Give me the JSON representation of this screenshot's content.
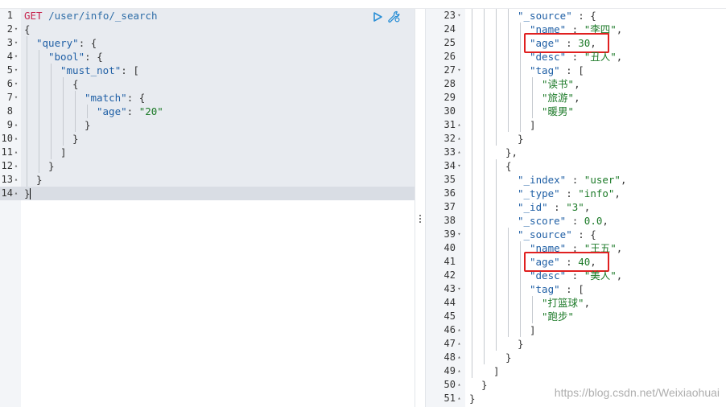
{
  "request": {
    "method": "GET",
    "path": "/user/info/_search",
    "lines": [
      {
        "n": "1",
        "fold": "",
        "indent": 0,
        "tokens": [
          [
            "kw-method",
            "GET"
          ],
          [
            "punc",
            " "
          ],
          [
            "kw-path",
            "/user/info/_search"
          ]
        ]
      },
      {
        "n": "2",
        "fold": "▾",
        "indent": 0,
        "tokens": [
          [
            "punc",
            "{"
          ]
        ]
      },
      {
        "n": "3",
        "fold": "▾",
        "indent": 1,
        "tokens": [
          [
            "key",
            "\"query\""
          ],
          [
            "punc",
            ": {"
          ]
        ]
      },
      {
        "n": "4",
        "fold": "▾",
        "indent": 2,
        "tokens": [
          [
            "key",
            "\"bool\""
          ],
          [
            "punc",
            ": {"
          ]
        ]
      },
      {
        "n": "5",
        "fold": "▾",
        "indent": 3,
        "tokens": [
          [
            "key",
            "\"must_not\""
          ],
          [
            "punc",
            ": ["
          ]
        ]
      },
      {
        "n": "6",
        "fold": "▾",
        "indent": 4,
        "tokens": [
          [
            "punc",
            "{"
          ]
        ]
      },
      {
        "n": "7",
        "fold": "▾",
        "indent": 5,
        "tokens": [
          [
            "key",
            "\"match\""
          ],
          [
            "punc",
            ": {"
          ]
        ]
      },
      {
        "n": "8",
        "fold": "",
        "indent": 6,
        "tokens": [
          [
            "key",
            "\"age\""
          ],
          [
            "punc",
            ": "
          ],
          [
            "str",
            "\"20\""
          ]
        ]
      },
      {
        "n": "9",
        "fold": "▴",
        "indent": 5,
        "tokens": [
          [
            "punc",
            "}"
          ]
        ]
      },
      {
        "n": "10",
        "fold": "▴",
        "indent": 4,
        "tokens": [
          [
            "punc",
            "}"
          ]
        ]
      },
      {
        "n": "11",
        "fold": "▴",
        "indent": 3,
        "tokens": [
          [
            "punc",
            "]"
          ]
        ]
      },
      {
        "n": "12",
        "fold": "▴",
        "indent": 2,
        "tokens": [
          [
            "punc",
            "}"
          ]
        ]
      },
      {
        "n": "13",
        "fold": "▴",
        "indent": 1,
        "tokens": [
          [
            "punc",
            "}"
          ]
        ]
      },
      {
        "n": "14",
        "fold": "▴",
        "indent": 0,
        "tokens": [
          [
            "punc",
            "}"
          ]
        ]
      }
    ]
  },
  "toolbar": {
    "run_icon": "play-icon",
    "settings_icon": "wrench-icon",
    "accent_color": "#2b8fd6"
  },
  "divider": {
    "handle_icon": "drag-dots-icon"
  },
  "response": {
    "lines": [
      {
        "n": "23",
        "fold": "▾",
        "indent": 3,
        "tokens": [
          [
            "key",
            "\"_source\""
          ],
          [
            "punc",
            " : {"
          ]
        ]
      },
      {
        "n": "24",
        "fold": "",
        "indent": 4,
        "tokens": [
          [
            "key",
            "\"name\""
          ],
          [
            "punc",
            " : "
          ],
          [
            "str",
            "\"李四\""
          ],
          [
            "punc",
            ","
          ]
        ]
      },
      {
        "n": "25",
        "fold": "",
        "indent": 4,
        "tokens": [
          [
            "key",
            "\"age\""
          ],
          [
            "punc",
            " : "
          ],
          [
            "num",
            "30"
          ],
          [
            "punc",
            ","
          ]
        ]
      },
      {
        "n": "26",
        "fold": "",
        "indent": 4,
        "tokens": [
          [
            "key",
            "\"desc\""
          ],
          [
            "punc",
            " : "
          ],
          [
            "str",
            "\"丑人\""
          ],
          [
            "punc",
            ","
          ]
        ]
      },
      {
        "n": "27",
        "fold": "▾",
        "indent": 4,
        "tokens": [
          [
            "key",
            "\"tag\""
          ],
          [
            "punc",
            " : ["
          ]
        ]
      },
      {
        "n": "28",
        "fold": "",
        "indent": 5,
        "tokens": [
          [
            "str",
            "\"读书\""
          ],
          [
            "punc",
            ","
          ]
        ]
      },
      {
        "n": "29",
        "fold": "",
        "indent": 5,
        "tokens": [
          [
            "str",
            "\"旅游\""
          ],
          [
            "punc",
            ","
          ]
        ]
      },
      {
        "n": "30",
        "fold": "",
        "indent": 5,
        "tokens": [
          [
            "str",
            "\"暖男\""
          ]
        ]
      },
      {
        "n": "31",
        "fold": "▴",
        "indent": 4,
        "tokens": [
          [
            "punc",
            "]"
          ]
        ]
      },
      {
        "n": "32",
        "fold": "▴",
        "indent": 3,
        "tokens": [
          [
            "punc",
            "}"
          ]
        ]
      },
      {
        "n": "33",
        "fold": "▴",
        "indent": 2,
        "tokens": [
          [
            "punc",
            "},"
          ]
        ]
      },
      {
        "n": "34",
        "fold": "▾",
        "indent": 2,
        "tokens": [
          [
            "punc",
            "{"
          ]
        ]
      },
      {
        "n": "35",
        "fold": "",
        "indent": 3,
        "tokens": [
          [
            "key",
            "\"_index\""
          ],
          [
            "punc",
            " : "
          ],
          [
            "str",
            "\"user\""
          ],
          [
            "punc",
            ","
          ]
        ]
      },
      {
        "n": "36",
        "fold": "",
        "indent": 3,
        "tokens": [
          [
            "key",
            "\"_type\""
          ],
          [
            "punc",
            " : "
          ],
          [
            "str",
            "\"info\""
          ],
          [
            "punc",
            ","
          ]
        ]
      },
      {
        "n": "37",
        "fold": "",
        "indent": 3,
        "tokens": [
          [
            "key",
            "\"_id\""
          ],
          [
            "punc",
            " : "
          ],
          [
            "str",
            "\"3\""
          ],
          [
            "punc",
            ","
          ]
        ]
      },
      {
        "n": "38",
        "fold": "",
        "indent": 3,
        "tokens": [
          [
            "key",
            "\"_score\""
          ],
          [
            "punc",
            " : "
          ],
          [
            "num",
            "0.0"
          ],
          [
            "punc",
            ","
          ]
        ]
      },
      {
        "n": "39",
        "fold": "▾",
        "indent": 3,
        "tokens": [
          [
            "key",
            "\"_source\""
          ],
          [
            "punc",
            " : {"
          ]
        ]
      },
      {
        "n": "40",
        "fold": "",
        "indent": 4,
        "tokens": [
          [
            "key",
            "\"name\""
          ],
          [
            "punc",
            " : "
          ],
          [
            "str",
            "\"王五\""
          ],
          [
            "punc",
            ","
          ]
        ]
      },
      {
        "n": "41",
        "fold": "",
        "indent": 4,
        "tokens": [
          [
            "key",
            "\"age\""
          ],
          [
            "punc",
            " : "
          ],
          [
            "num",
            "40"
          ],
          [
            "punc",
            ","
          ]
        ]
      },
      {
        "n": "42",
        "fold": "",
        "indent": 4,
        "tokens": [
          [
            "key",
            "\"desc\""
          ],
          [
            "punc",
            " : "
          ],
          [
            "str",
            "\"美人\""
          ],
          [
            "punc",
            ","
          ]
        ]
      },
      {
        "n": "43",
        "fold": "▾",
        "indent": 4,
        "tokens": [
          [
            "key",
            "\"tag\""
          ],
          [
            "punc",
            " : ["
          ]
        ]
      },
      {
        "n": "44",
        "fold": "",
        "indent": 5,
        "tokens": [
          [
            "str",
            "\"打篮球\""
          ],
          [
            "punc",
            ","
          ]
        ]
      },
      {
        "n": "45",
        "fold": "",
        "indent": 5,
        "tokens": [
          [
            "str",
            "\"跑步\""
          ]
        ]
      },
      {
        "n": "46",
        "fold": "▴",
        "indent": 4,
        "tokens": [
          [
            "punc",
            "]"
          ]
        ]
      },
      {
        "n": "47",
        "fold": "▴",
        "indent": 3,
        "tokens": [
          [
            "punc",
            "}"
          ]
        ]
      },
      {
        "n": "48",
        "fold": "▴",
        "indent": 2,
        "tokens": [
          [
            "punc",
            "}"
          ]
        ]
      },
      {
        "n": "49",
        "fold": "▴",
        "indent": 1,
        "tokens": [
          [
            "punc",
            "]"
          ]
        ]
      },
      {
        "n": "50",
        "fold": "▴",
        "indent": 0,
        "tokens": [
          [
            "punc",
            "}"
          ]
        ]
      },
      {
        "n": "51",
        "fold": "▴",
        "indent": -1,
        "tokens": [
          [
            "punc",
            "}"
          ]
        ]
      }
    ],
    "highlight_lines": [
      "25",
      "41"
    ],
    "highlight_color": "#e02020"
  },
  "watermark": "https://blog.csdn.net/Weixiaohuai"
}
